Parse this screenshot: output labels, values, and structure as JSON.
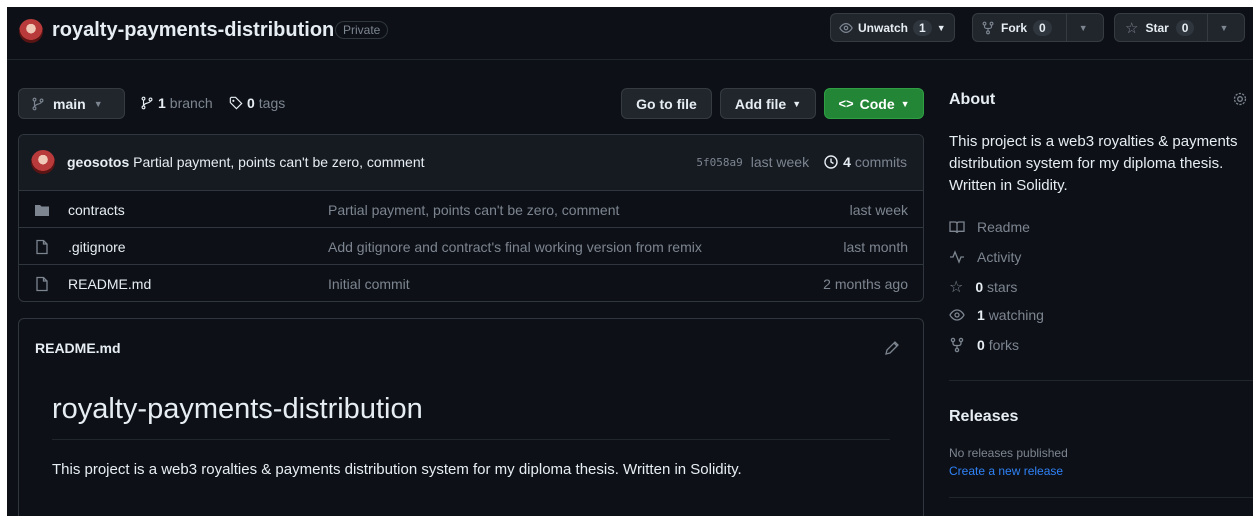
{
  "repo": {
    "name": "royalty-payments-distribution",
    "visibility": "Private"
  },
  "header_actions": {
    "unwatch_label": "Unwatch",
    "unwatch_count": "1",
    "fork_label": "Fork",
    "fork_count": "0",
    "star_label": "Star",
    "star_count": "0"
  },
  "toolbar": {
    "branch_name": "main",
    "branches_count": "1",
    "branches_label": "branch",
    "tags_count": "0",
    "tags_label": "tags",
    "go_to_file": "Go to file",
    "add_file": "Add file",
    "code": "Code"
  },
  "latest_commit": {
    "author": "geosotos",
    "message": "Partial payment, points can't be zero, comment",
    "sha": "5f058a9",
    "age": "last week",
    "commits_count": "4",
    "commits_label": "commits"
  },
  "files": [
    {
      "name": "contracts",
      "type": "folder",
      "message": "Partial payment, points can't be zero, comment",
      "age": "last week"
    },
    {
      "name": ".gitignore",
      "type": "file",
      "message": "Add gitignore and contract's final working version from remix",
      "age": "last month"
    },
    {
      "name": "README.md",
      "type": "file",
      "message": "Initial commit",
      "age": "2 months ago"
    }
  ],
  "readme": {
    "filename": "README.md",
    "heading": "royalty-payments-distribution",
    "body": "This project is a web3 royalties & payments distribution system for my diploma thesis. Written in Solidity."
  },
  "about": {
    "title": "About",
    "description": "This project is a web3 royalties & payments distribution system for my diploma thesis. Written in Solidity.",
    "readme": "Readme",
    "activity": "Activity",
    "stars_count": "0",
    "stars_label": "stars",
    "watching_count": "1",
    "watching_label": "watching",
    "forks_count": "0",
    "forks_label": "forks"
  },
  "releases": {
    "title": "Releases",
    "none": "No releases published",
    "create": "Create a new release"
  },
  "colors": {
    "background": "#0d1117",
    "code_button": "#238636",
    "link": "#2f81f7",
    "border": "#30363d"
  }
}
